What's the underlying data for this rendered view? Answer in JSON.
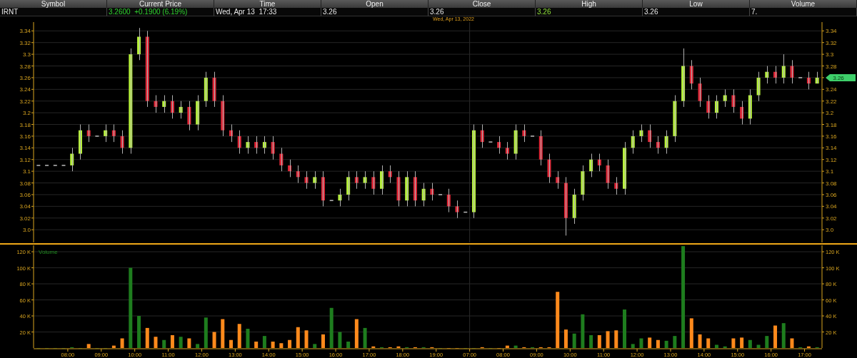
{
  "quote_table": {
    "columns": [
      "Symbol",
      "Current Price",
      "Time",
      "Open",
      "Close",
      "High",
      "Low",
      "Volume"
    ],
    "row": [
      {
        "text": "IRNT",
        "kind": "plain"
      },
      {
        "text": "3.2600  +0.1900 (6.19%)",
        "kind": "change"
      },
      {
        "text": "Wed, Apr 13  17:33",
        "kind": "plain"
      },
      {
        "text": "3.26",
        "kind": "plain"
      },
      {
        "text": "3.26",
        "kind": "plain"
      },
      {
        "text": "3.26",
        "kind": "high"
      },
      {
        "text": "3.26",
        "kind": "plain"
      },
      {
        "text": "7.",
        "kind": "plain"
      }
    ]
  },
  "date_label": "Wed, Apr 13, 2022",
  "price_chart": {
    "last_price_tag": "3.26",
    "right_axis": [
      "3.34",
      "3.32",
      "3.3",
      "3.28",
      "3.24",
      "3.22",
      "3.2",
      "3.18",
      "3.16",
      "3.14",
      "3.12",
      "3.1",
      "3.08",
      "3.06",
      "3.04",
      "3.02",
      "3.0"
    ],
    "chart_data": {
      "type": "candlestick",
      "grid": true,
      "ylim": [
        2.977,
        3.355
      ],
      "yticks": [
        {
          "value": 3.34,
          "label": "3.34"
        },
        {
          "value": 3.32,
          "label": "3.32"
        },
        {
          "value": 3.3,
          "label": "3.3"
        },
        {
          "value": 3.28,
          "label": "3.28"
        },
        {
          "value": 3.26,
          "label": "3.26"
        },
        {
          "value": 3.24,
          "label": "3.24"
        },
        {
          "value": 3.22,
          "label": "3.22"
        },
        {
          "value": 3.2,
          "label": "3.2"
        },
        {
          "value": 3.18,
          "label": "3.18"
        },
        {
          "value": 3.16,
          "label": "3.16"
        },
        {
          "value": 3.14,
          "label": "3.14"
        },
        {
          "value": 3.12,
          "label": "3.12"
        },
        {
          "value": 3.1,
          "label": "3.1"
        },
        {
          "value": 3.08,
          "label": "3.08"
        },
        {
          "value": 3.06,
          "label": "3.06"
        },
        {
          "value": 3.04,
          "label": "3.04"
        },
        {
          "value": 3.02,
          "label": "3.02"
        },
        {
          "value": 3.0,
          "label": "3.0"
        }
      ],
      "ohlc": [
        [
          3.11,
          3.11,
          3.11,
          3.11
        ],
        [
          3.11,
          3.11,
          3.11,
          3.11
        ],
        [
          3.11,
          3.11,
          3.11,
          3.11
        ],
        [
          3.11,
          3.11,
          3.11,
          3.11
        ],
        [
          3.11,
          3.14,
          3.1,
          3.13
        ],
        [
          3.13,
          3.18,
          3.12,
          3.17
        ],
        [
          3.17,
          3.18,
          3.15,
          3.16
        ],
        [
          3.16,
          3.16,
          3.16,
          3.16
        ],
        [
          3.16,
          3.18,
          3.15,
          3.17
        ],
        [
          3.17,
          3.18,
          3.15,
          3.16
        ],
        [
          3.16,
          3.17,
          3.13,
          3.14
        ],
        [
          3.14,
          3.31,
          3.13,
          3.3
        ],
        [
          3.3,
          3.345,
          3.29,
          3.33
        ],
        [
          3.33,
          3.34,
          3.21,
          3.22
        ],
        [
          3.22,
          3.23,
          3.2,
          3.21
        ],
        [
          3.21,
          3.23,
          3.2,
          3.22
        ],
        [
          3.22,
          3.23,
          3.19,
          3.2
        ],
        [
          3.2,
          3.22,
          3.19,
          3.21
        ],
        [
          3.21,
          3.22,
          3.17,
          3.18
        ],
        [
          3.18,
          3.23,
          3.17,
          3.22
        ],
        [
          3.22,
          3.27,
          3.21,
          3.26
        ],
        [
          3.26,
          3.27,
          3.21,
          3.22
        ],
        [
          3.22,
          3.23,
          3.16,
          3.17
        ],
        [
          3.17,
          3.18,
          3.15,
          3.16
        ],
        [
          3.16,
          3.17,
          3.13,
          3.14
        ],
        [
          3.14,
          3.16,
          3.13,
          3.15
        ],
        [
          3.15,
          3.16,
          3.13,
          3.14
        ],
        [
          3.14,
          3.16,
          3.13,
          3.15
        ],
        [
          3.15,
          3.16,
          3.12,
          3.13
        ],
        [
          3.13,
          3.14,
          3.1,
          3.11
        ],
        [
          3.11,
          3.12,
          3.09,
          3.1
        ],
        [
          3.1,
          3.11,
          3.08,
          3.09
        ],
        [
          3.09,
          3.1,
          3.07,
          3.08
        ],
        [
          3.08,
          3.1,
          3.07,
          3.09
        ],
        [
          3.09,
          3.1,
          3.04,
          3.05
        ],
        [
          3.05,
          3.05,
          3.05,
          3.05
        ],
        [
          3.05,
          3.07,
          3.04,
          3.06
        ],
        [
          3.06,
          3.1,
          3.05,
          3.09
        ],
        [
          3.09,
          3.1,
          3.07,
          3.08
        ],
        [
          3.08,
          3.1,
          3.07,
          3.09
        ],
        [
          3.09,
          3.1,
          3.06,
          3.07
        ],
        [
          3.07,
          3.11,
          3.06,
          3.1
        ],
        [
          3.1,
          3.11,
          3.08,
          3.09
        ],
        [
          3.09,
          3.1,
          3.04,
          3.05
        ],
        [
          3.05,
          3.1,
          3.04,
          3.09
        ],
        [
          3.09,
          3.1,
          3.04,
          3.05
        ],
        [
          3.05,
          3.08,
          3.04,
          3.07
        ],
        [
          3.07,
          3.08,
          3.05,
          3.06
        ],
        [
          3.06,
          3.06,
          3.06,
          3.06
        ],
        [
          3.06,
          3.07,
          3.03,
          3.04
        ],
        [
          3.04,
          3.05,
          3.02,
          3.03
        ],
        [
          3.03,
          3.03,
          3.03,
          3.03
        ],
        [
          3.03,
          3.18,
          3.02,
          3.17
        ],
        [
          3.17,
          3.18,
          3.14,
          3.15
        ],
        [
          3.15,
          3.15,
          3.15,
          3.15
        ],
        [
          3.15,
          3.16,
          3.13,
          3.14
        ],
        [
          3.14,
          3.15,
          3.12,
          3.13
        ],
        [
          3.13,
          3.18,
          3.12,
          3.17
        ],
        [
          3.17,
          3.18,
          3.15,
          3.16
        ],
        [
          3.16,
          3.16,
          3.16,
          3.16
        ],
        [
          3.16,
          3.17,
          3.11,
          3.12
        ],
        [
          3.12,
          3.13,
          3.08,
          3.09
        ],
        [
          3.09,
          3.1,
          3.07,
          3.08
        ],
        [
          3.08,
          3.09,
          2.99,
          3.02
        ],
        [
          3.02,
          3.07,
          3.01,
          3.06
        ],
        [
          3.06,
          3.11,
          3.05,
          3.1
        ],
        [
          3.1,
          3.13,
          3.09,
          3.12
        ],
        [
          3.12,
          3.13,
          3.1,
          3.11
        ],
        [
          3.11,
          3.12,
          3.07,
          3.08
        ],
        [
          3.08,
          3.09,
          3.06,
          3.07
        ],
        [
          3.07,
          3.15,
          3.06,
          3.14
        ],
        [
          3.14,
          3.17,
          3.13,
          3.16
        ],
        [
          3.16,
          3.18,
          3.15,
          3.17
        ],
        [
          3.17,
          3.18,
          3.14,
          3.15
        ],
        [
          3.15,
          3.16,
          3.13,
          3.14
        ],
        [
          3.14,
          3.17,
          3.13,
          3.16
        ],
        [
          3.16,
          3.23,
          3.15,
          3.22
        ],
        [
          3.22,
          3.31,
          3.21,
          3.28
        ],
        [
          3.28,
          3.29,
          3.24,
          3.25
        ],
        [
          3.25,
          3.26,
          3.21,
          3.22
        ],
        [
          3.22,
          3.23,
          3.19,
          3.2
        ],
        [
          3.2,
          3.23,
          3.19,
          3.22
        ],
        [
          3.22,
          3.24,
          3.21,
          3.23
        ],
        [
          3.23,
          3.24,
          3.2,
          3.21
        ],
        [
          3.21,
          3.22,
          3.18,
          3.19
        ],
        [
          3.19,
          3.24,
          3.18,
          3.23
        ],
        [
          3.23,
          3.27,
          3.22,
          3.26
        ],
        [
          3.26,
          3.28,
          3.25,
          3.27
        ],
        [
          3.27,
          3.28,
          3.25,
          3.26
        ],
        [
          3.26,
          3.3,
          3.25,
          3.28
        ],
        [
          3.28,
          3.29,
          3.25,
          3.26
        ],
        [
          3.26,
          3.26,
          3.26,
          3.26
        ],
        [
          3.26,
          3.27,
          3.24,
          3.25
        ],
        [
          3.25,
          3.27,
          3.25,
          3.26
        ]
      ]
    }
  },
  "volume_chart": {
    "legend": "Volume",
    "right_axis": [
      "120 K",
      "100 K",
      "80 K",
      "60 K",
      "40 K",
      "20 K"
    ],
    "chart_data": {
      "type": "bar",
      "grid": true,
      "ylim": [
        0,
        128
      ],
      "categories": [
        null,
        null,
        null,
        null,
        "08:00",
        null,
        null,
        null,
        "09:00",
        null,
        null,
        null,
        "10:00",
        null,
        null,
        null,
        "11:00",
        null,
        null,
        null,
        "12:00",
        null,
        null,
        null,
        "13:00",
        null,
        null,
        null,
        "14:00",
        null,
        null,
        null,
        "15:00",
        null,
        null,
        null,
        "16:00",
        null,
        null,
        null,
        "17:00",
        null,
        null,
        null,
        "18:00",
        null,
        null,
        null,
        "19:00",
        null,
        null,
        null,
        "07:00",
        null,
        null,
        null,
        "08:00",
        null,
        null,
        null,
        "09:00",
        null,
        null,
        null,
        "10:00",
        null,
        null,
        null,
        "11:00",
        null,
        null,
        null,
        "12:00",
        null,
        null,
        null,
        "13:00",
        null,
        null,
        null,
        "14:00",
        null,
        null,
        null,
        "15:00",
        null,
        null,
        null,
        "16:00",
        null,
        null,
        null,
        "17:00",
        null
      ],
      "yticks": [
        {
          "value": 120,
          "label": "120 K"
        },
        {
          "value": 100,
          "label": "100 K"
        },
        {
          "value": 80,
          "label": "80 K"
        },
        {
          "value": 60,
          "label": "60 K"
        },
        {
          "value": 40,
          "label": "40 K"
        },
        {
          "value": 20,
          "label": "20 K"
        }
      ],
      "values": [
        0,
        0,
        0,
        0,
        1,
        0,
        5,
        0,
        0,
        3,
        12,
        100,
        40,
        25,
        14,
        10,
        16,
        14,
        12,
        5,
        38,
        20,
        36,
        10,
        30,
        24,
        8,
        15,
        8,
        6,
        10,
        26,
        22,
        5,
        17,
        50,
        20,
        8,
        36,
        25,
        2,
        1,
        1,
        2,
        1,
        1,
        1,
        1,
        0,
        0,
        0,
        0,
        0,
        1,
        0,
        0,
        3,
        3,
        1,
        1,
        1,
        1,
        70,
        23,
        18,
        42,
        16,
        16,
        21,
        22,
        48,
        5,
        12,
        13,
        10,
        9,
        15,
        127,
        37,
        17,
        12,
        4,
        2,
        12,
        13,
        10,
        4,
        15,
        28,
        31,
        12,
        1,
        2,
        1
      ]
    }
  }
}
